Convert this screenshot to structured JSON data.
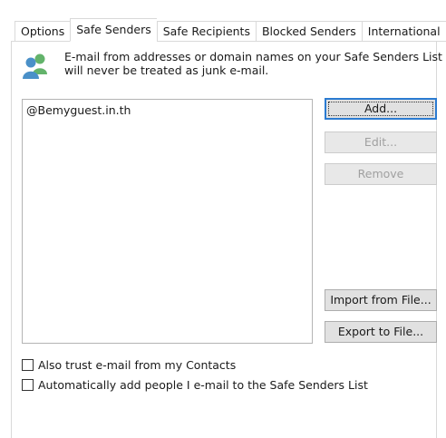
{
  "tabs": [
    {
      "label": "Options"
    },
    {
      "label": "Safe Senders"
    },
    {
      "label": "Safe Recipients"
    },
    {
      "label": "Blocked Senders"
    },
    {
      "label": "International"
    }
  ],
  "active_tab": "Safe Senders",
  "info": {
    "line1": "E-mail from addresses or domain names on your Safe Senders List",
    "line2": "will never be treated as junk e-mail.",
    "icon": "people-icon"
  },
  "list": {
    "items": [
      "@Bemyguest.in.th"
    ]
  },
  "buttons": {
    "add": "Add...",
    "edit": "Edit...",
    "remove": "Remove",
    "import": "Import from File...",
    "export": "Export to File..."
  },
  "checkboxes": {
    "trust_contacts": {
      "label": "Also trust e-mail from my Contacts",
      "checked": false
    },
    "auto_add": {
      "label": "Automatically add people I e-mail to the Safe Senders List",
      "checked": false
    }
  },
  "colors": {
    "accent": "#2b7bd1",
    "icon_person_front": "#4a90c8",
    "icon_person_back": "#63b36b"
  }
}
